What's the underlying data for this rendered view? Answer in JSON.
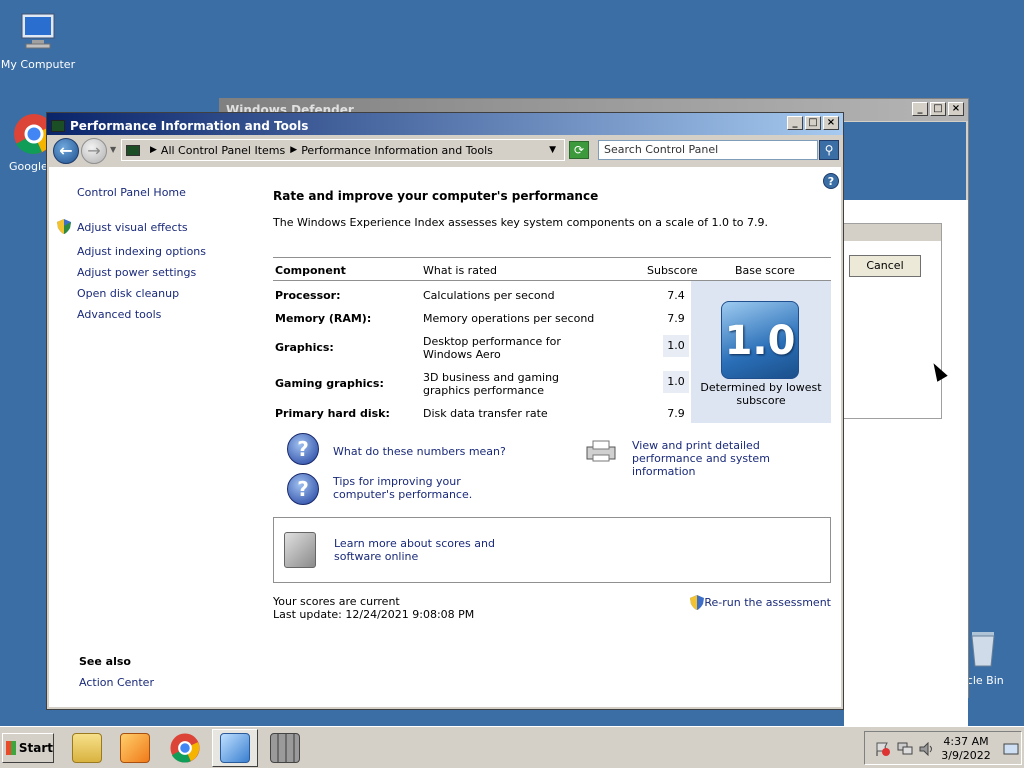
{
  "desktop": {
    "icons": [
      {
        "label": "My Computer"
      },
      {
        "label": "Google C"
      },
      {
        "label": "ycle Bin"
      }
    ]
  },
  "background_window": {
    "title": "Windows Defender",
    "cancel_label": "Cancel"
  },
  "window": {
    "title": "Performance Information and Tools",
    "minimize": "_",
    "maximize": "□",
    "close": "×"
  },
  "navbar": {
    "breadcrumb": [
      "All Control Panel Items",
      "Performance Information and Tools"
    ],
    "search_placeholder": "Search Control Panel"
  },
  "sidebar": {
    "home": "Control Panel Home",
    "links": [
      "Adjust visual effects",
      "Adjust indexing options",
      "Adjust power settings",
      "Open disk cleanup",
      "Advanced tools"
    ],
    "see_also_heading": "See also",
    "see_also_links": [
      "Action Center"
    ]
  },
  "main": {
    "heading": "Rate and improve your computer's performance",
    "description": "The Windows Experience Index assesses key system components on a scale of 1.0 to 7.9.",
    "table": {
      "headers": [
        "Component",
        "What is rated",
        "Subscore",
        "Base score"
      ],
      "rows": [
        {
          "component": "Processor:",
          "rated": "Calculations per second",
          "subscore": "7.4"
        },
        {
          "component": "Memory (RAM):",
          "rated": "Memory operations per second",
          "subscore": "7.9"
        },
        {
          "component": "Graphics:",
          "rated": "Desktop performance for Windows Aero",
          "subscore": "1.0"
        },
        {
          "component": "Gaming graphics:",
          "rated": "3D business and gaming graphics performance",
          "subscore": "1.0"
        },
        {
          "component": "Primary hard disk:",
          "rated": "Disk data transfer rate",
          "subscore": "7.9"
        }
      ],
      "base_score": "1.0",
      "base_score_note": "Determined by lowest subscore"
    },
    "links": {
      "numbers_meaning": "What do these numbers mean?",
      "tips": "Tips for improving your computer's performance.",
      "view_print": "View and print detailed performance and system information",
      "learn_more": "Learn more about scores and software online"
    },
    "status_line1": "Your scores are current",
    "status_line2": "Last update: 12/24/2021 9:08:08 PM",
    "rerun": "Re-run the assessment"
  },
  "taskbar": {
    "start_label": "Start",
    "time": "4:37 AM",
    "date": "3/9/2022"
  }
}
